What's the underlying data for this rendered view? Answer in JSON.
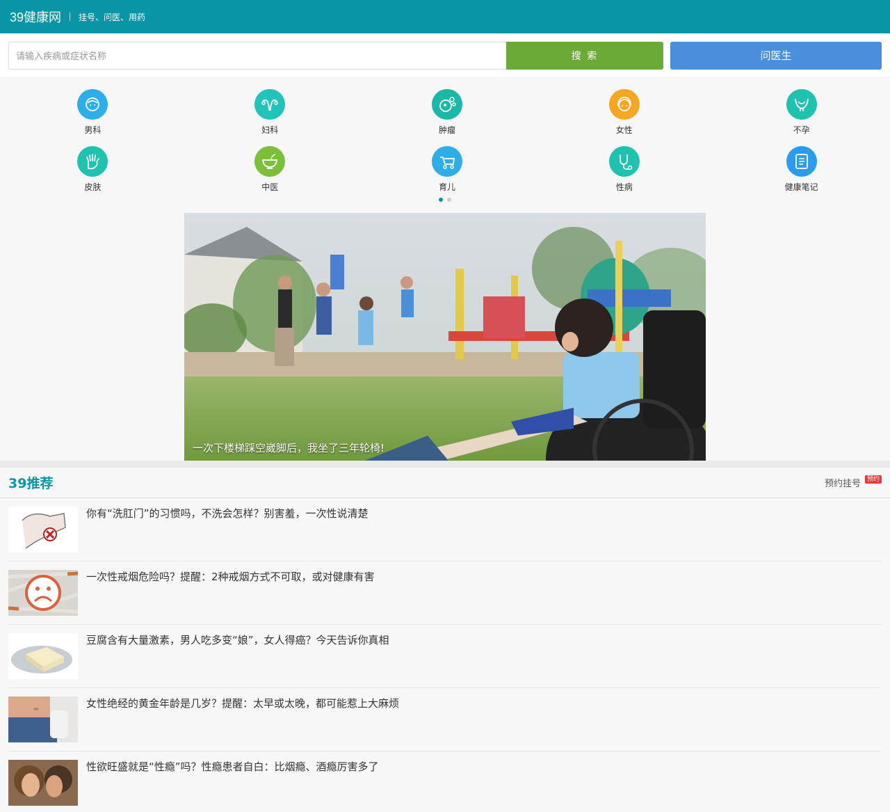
{
  "header": {
    "logo_mark": "39",
    "logo_text": "39健康网",
    "slogan": "挂号、问医、用药"
  },
  "search": {
    "placeholder": "请输入疾病或症状名称",
    "button_label": "搜 索",
    "ask_doctor_label": "问医生"
  },
  "categories": [
    {
      "label": "男科",
      "icon": "male-face-icon",
      "color": "#2eaee8"
    },
    {
      "label": "妇科",
      "icon": "uterus-icon",
      "color": "#22c3b8"
    },
    {
      "label": "肿瘤",
      "icon": "tumor-cells-icon",
      "color": "#1ab8a6"
    },
    {
      "label": "女性",
      "icon": "female-face-icon",
      "color": "#f6a623"
    },
    {
      "label": "不孕",
      "icon": "pelvis-icon",
      "color": "#1ec2ae"
    },
    {
      "label": "皮肤",
      "icon": "hand-skin-icon",
      "color": "#1ec2ae"
    },
    {
      "label": "中医",
      "icon": "herbal-bowl-icon",
      "color": "#7cbf3a"
    },
    {
      "label": "育儿",
      "icon": "baby-stroller-icon",
      "color": "#2eaee8"
    },
    {
      "label": "性病",
      "icon": "stethoscope-icon",
      "color": "#1ec2ae"
    },
    {
      "label": "健康笔记",
      "icon": "notebook-icon",
      "color": "#2a9cee"
    }
  ],
  "carousel": {
    "pages": 2,
    "active": 1
  },
  "banner": {
    "caption": "一次下楼梯踩空崴脚后，我坐了三年轮椅!"
  },
  "recommend": {
    "title": "39推荐",
    "link_label": "预约挂号",
    "badge": "预约"
  },
  "news": [
    {
      "title": "你有“洗肛门”的习惯吗，不洗会怎样？别害羞，一次性说清楚",
      "thumb": "hygiene-illustration"
    },
    {
      "title": "一次性戒烟危险吗？提醒：2种戒烟方式不可取，或对健康有害",
      "thumb": "cigarettes-sad-face"
    },
    {
      "title": "豆腐含有大量激素，男人吃多变“娘”，女人得癌？今天告诉你真相",
      "thumb": "tofu-plate"
    },
    {
      "title": "女性绝经的黄金年龄是几岁？提醒：太早或太晚，都可能惹上大麻烦",
      "thumb": "waist-jeans"
    },
    {
      "title": "性欲旺盛就是“性瘾”吗？性瘾患者自白：比烟瘾、酒瘾厉害多了",
      "thumb": "couple-photo"
    }
  ],
  "colors": {
    "brand": "#0896a6",
    "search_green": "#6aab38",
    "ask_blue": "#4a8fdc",
    "badge_red": "#e8383d"
  }
}
